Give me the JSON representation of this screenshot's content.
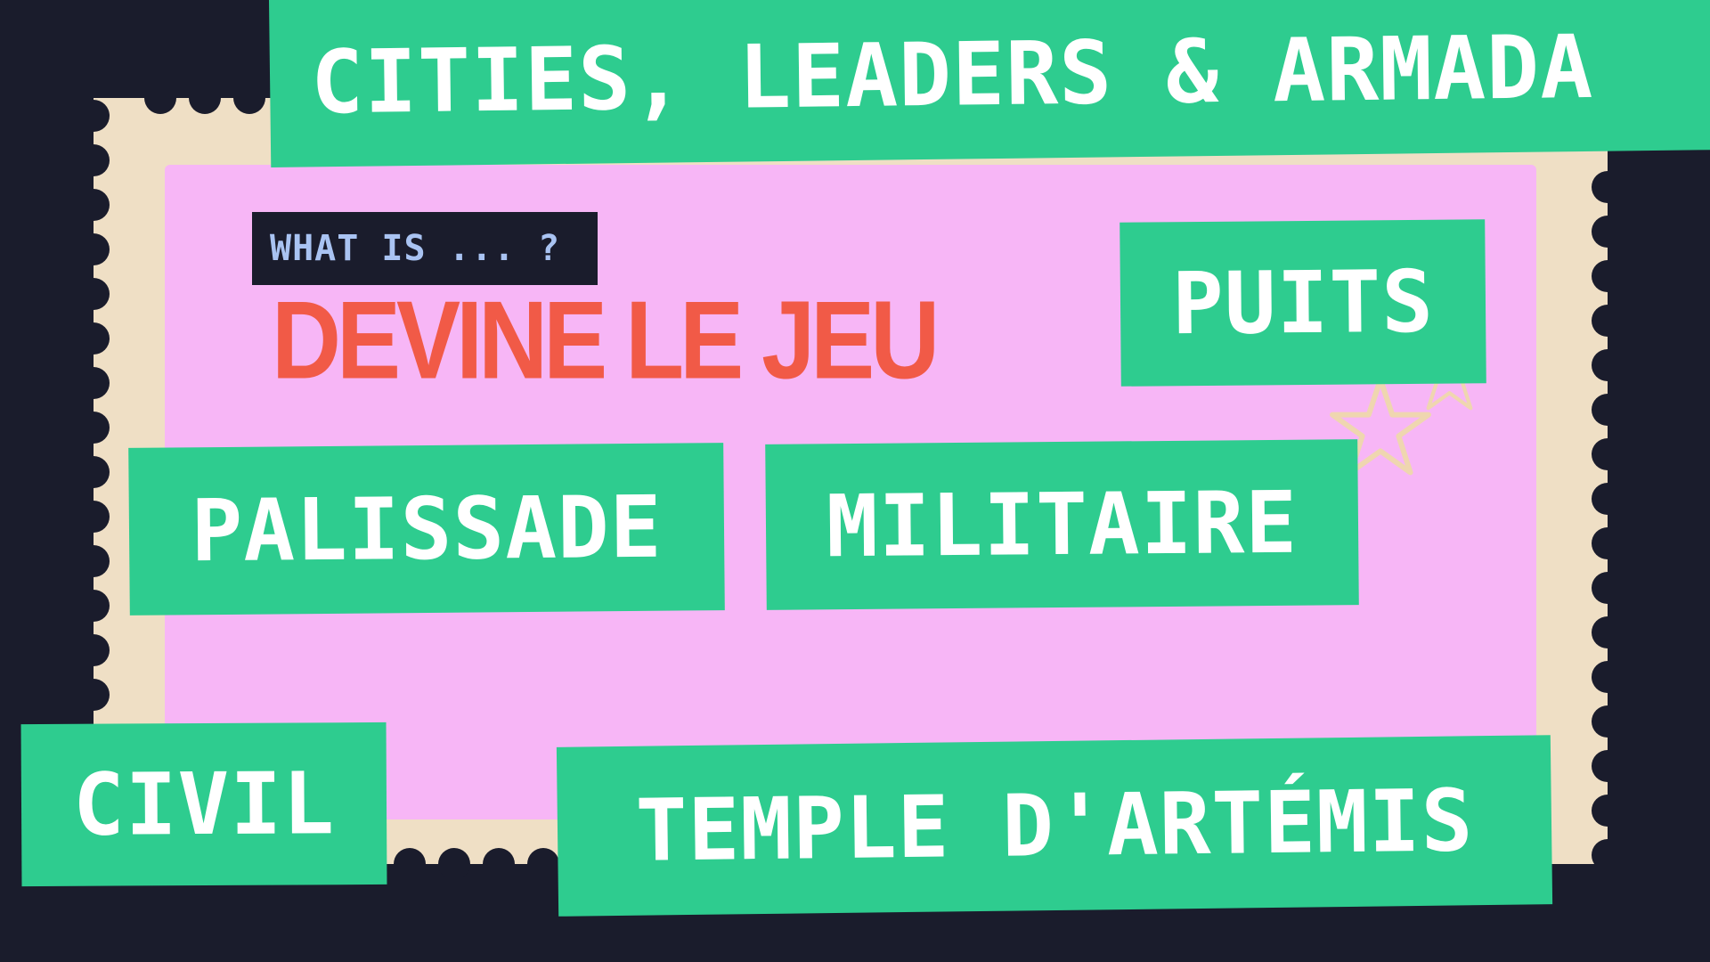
{
  "title": "CITIES, LEADERS & ARMADA",
  "header_badge": "WHAT IS ... ?",
  "headline": "DEVINE LE JEU",
  "word_tags": {
    "puits": "PUITS",
    "palissade": "PALISSADE",
    "militaire": "MILITAIRE",
    "civil": "CIVIL",
    "temple": "TEMPLE D'ARTÉMIS"
  },
  "colors": {
    "background": "#1a1c2c",
    "stamp_border": "#efdfc5",
    "stamp_fill": "#f7b6f6",
    "tag_fill": "#2ecc8f",
    "tag_text": "#ffffff",
    "headline": "#f15a47",
    "badge_text": "#a9c3f2"
  },
  "decor": {
    "icon": "star-doodle-icon"
  }
}
